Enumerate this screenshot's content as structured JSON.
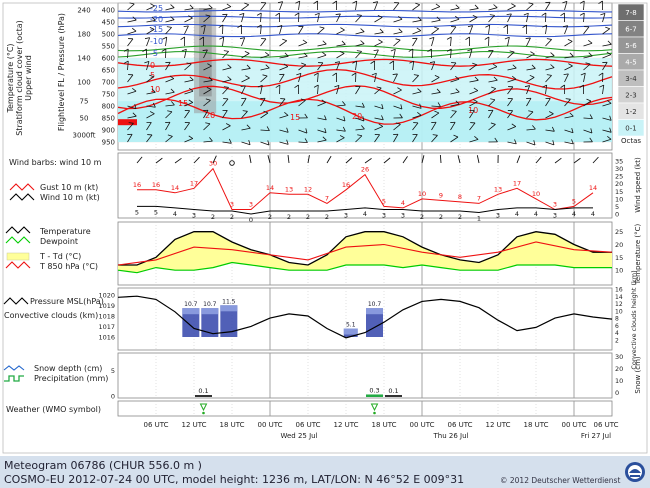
{
  "footer": {
    "title": "Meteogram 06786 (CHUR  556.0 m )",
    "model": "COSMO-EU 2012-07-24  00 UTC, model height: 1236 m,  LAT/LON: N 46°52 E 009°31",
    "copyright": "© 2012 Deutscher Wetterdienst"
  },
  "colors": {
    "temperature": "#000000",
    "dewpoint": "#00cc00",
    "gust": "#ee1111",
    "t850": "#ee1111",
    "fill": "#ffff99",
    "pressure": "#000000",
    "convective": "#3344aa"
  },
  "time_axis": {
    "hour_labels": [
      "06 UTC",
      "12 UTC",
      "18 UTC",
      "00 UTC",
      "06 UTC",
      "12 UTC",
      "18 UTC",
      "00 UTC",
      "06 UTC",
      "12 UTC",
      "18 UTC",
      "00 UTC",
      "06 UTC"
    ],
    "day_labels": [
      "Wed 25 Jul",
      "Thu 26 Jul",
      "Fri 27 Jul"
    ]
  },
  "panels": {
    "upper_air": {
      "left_labels": [
        "Temperature (°C)",
        "Stratiform cloud cover (octa)",
        "Upper wind"
      ],
      "axis_title": "Flightlevel FL / Pressure (hPa)",
      "fl_ticks": [
        "240",
        "180",
        "140",
        "100",
        "75",
        "50",
        "3000ft"
      ],
      "hpa_ticks": [
        "400",
        "450",
        "500",
        "550",
        "600",
        "650",
        "700",
        "750",
        "800",
        "850",
        "900",
        "950"
      ],
      "octa_labels": [
        "7-8",
        "6-7",
        "5-6",
        "4-5",
        "3-4",
        "2-3",
        "1-2",
        "0-1"
      ],
      "octa_title": "Octas",
      "isotherm_labels": [
        "-25",
        "-20",
        "-15",
        "-10",
        "-5",
        "0",
        "5",
        "10",
        "15",
        "20",
        "15",
        "20",
        "10"
      ]
    },
    "wind": {
      "left_labels": [
        "Wind barbs: wind 10 m",
        "Gust 10 m (kt)",
        "Wind 10 m (kt)"
      ],
      "right_title": "Wind speed (kt)",
      "right_ticks": [
        "35",
        "30",
        "25",
        "20",
        "15",
        "10",
        "5",
        "0"
      ]
    },
    "temp": {
      "legend": [
        "Temperature",
        "Dewpoint",
        "T - Td (°C)",
        "T 850 hPa (°C)"
      ],
      "right_title": "Temperature (°C)",
      "right_ticks": [
        "25",
        "20",
        "15",
        "10"
      ]
    },
    "pressure": {
      "legend": [
        "Pressure MSL(hPa)",
        "Convective clouds (km)"
      ],
      "left_ticks": [
        "1020",
        "1019",
        "1018",
        "1017",
        "1016"
      ],
      "right_title": "Convective clouds height (km)",
      "right_ticks": [
        "16",
        "14",
        "12",
        "10",
        "8",
        "6",
        "4",
        "2"
      ]
    },
    "precip": {
      "legend": [
        "Snow depth (cm)",
        "Precipitation (mm)"
      ],
      "left_ticks": [
        "5",
        "0"
      ],
      "right_title": "Snow (cm)",
      "right_ticks": [
        "30",
        "20",
        "10",
        "0"
      ]
    },
    "weather": {
      "legend": "Weather (WMO symbol)"
    }
  },
  "chart_data": [
    {
      "type": "line",
      "title": "Wind 10 m",
      "ylabel": "Wind speed (kt)",
      "ylim": [
        0,
        35
      ],
      "series": [
        {
          "name": "Gust 10 m (kt)",
          "x": [
            3,
            6,
            9,
            12,
            15,
            18,
            21,
            24,
            27,
            30,
            33,
            36,
            39,
            42,
            45,
            48,
            51,
            54,
            57,
            60,
            63,
            66,
            69,
            72,
            75
          ],
          "values": [
            16,
            16,
            14,
            17,
            30,
            3,
            3,
            14,
            13,
            13,
            7,
            16,
            26,
            5,
            4,
            10,
            9,
            8,
            7,
            13,
            17,
            10,
            3,
            5,
            14
          ],
          "labels": [
            "16",
            "16",
            "14",
            "17",
            "30",
            "3",
            "3",
            "14",
            "13",
            "12",
            "7",
            "16",
            "26",
            "5",
            "4",
            "10",
            "9",
            "8",
            "7",
            "13",
            "17",
            "10",
            "3",
            "5",
            "14"
          ]
        },
        {
          "name": "Wind 10 m (kt)",
          "x": [
            3,
            6,
            9,
            12,
            15,
            18,
            21,
            24,
            27,
            30,
            33,
            36,
            39,
            42,
            45,
            48,
            51,
            54,
            57,
            60,
            63,
            66,
            69,
            72,
            75
          ],
          "values": [
            5,
            5,
            4,
            3,
            2,
            2,
            0,
            2,
            2,
            2,
            2,
            3,
            4,
            3,
            3,
            2,
            2,
            2,
            1,
            3,
            4,
            4,
            3,
            4,
            4
          ],
          "labels": [
            "5",
            "5",
            "4",
            "3",
            "2",
            "2",
            "0",
            "2",
            "2",
            "2",
            "2",
            "3",
            "4",
            "3",
            "3",
            "2",
            "2",
            "2",
            "1",
            "3",
            "4",
            "4",
            "3",
            "4",
            "4"
          ]
        }
      ]
    },
    {
      "type": "line",
      "title": "Temperature",
      "ylabel": "Temperature (°C)",
      "ylim": [
        5,
        28
      ],
      "series": [
        {
          "name": "Temperature",
          "x": [
            0,
            3,
            6,
            9,
            12,
            15,
            18,
            21,
            24,
            27,
            30,
            33,
            36,
            39,
            42,
            45,
            48,
            51,
            54,
            57,
            60,
            63,
            66,
            69,
            72,
            75,
            78
          ],
          "values": [
            12,
            12,
            15,
            22,
            25,
            25,
            21,
            18,
            16,
            13,
            12,
            16,
            23,
            25,
            25,
            23,
            19,
            16,
            14,
            13,
            16,
            23,
            25,
            24,
            20,
            17,
            17
          ]
        },
        {
          "name": "Dewpoint",
          "x": [
            0,
            3,
            6,
            9,
            12,
            15,
            18,
            21,
            24,
            27,
            30,
            33,
            36,
            39,
            42,
            45,
            48,
            51,
            54,
            57,
            60,
            63,
            66,
            69,
            72,
            75,
            78
          ],
          "values": [
            10,
            9,
            11,
            10,
            10,
            11,
            13,
            12,
            11,
            10,
            10,
            10,
            12,
            12,
            12,
            11,
            12,
            11,
            10,
            10,
            10,
            12,
            12,
            12,
            11,
            11,
            11
          ]
        },
        {
          "name": "T 850 hPa (°C)",
          "x": [
            0,
            6,
            12,
            18,
            24,
            30,
            36,
            42,
            48,
            54,
            60,
            66,
            72,
            78
          ],
          "values": [
            12,
            14,
            19,
            18,
            16,
            14,
            19,
            20,
            17,
            15,
            17,
            21,
            18,
            17
          ]
        }
      ]
    },
    {
      "type": "line",
      "title": "Pressure MSL",
      "ylabel": "Pressure MSL(hPa)",
      "ylim": [
        1015.5,
        1020.5
      ],
      "series": [
        {
          "name": "Pressure MSL(hPa)",
          "x": [
            0,
            3,
            6,
            9,
            12,
            15,
            18,
            21,
            24,
            27,
            30,
            33,
            36,
            39,
            42,
            45,
            48,
            51,
            54,
            57,
            60,
            63,
            66,
            69,
            72,
            75,
            78
          ],
          "values": [
            1019.8,
            1019.9,
            1019.6,
            1018.4,
            1016.8,
            1016.3,
            1016.5,
            1017.0,
            1017.8,
            1018.2,
            1018.0,
            1016.8,
            1015.9,
            1016.4,
            1017.4,
            1018.6,
            1019.4,
            1019.6,
            1019.4,
            1018.8,
            1017.6,
            1016.6,
            1016.9,
            1017.8,
            1018.2,
            1017.9,
            1017.7
          ]
        }
      ]
    },
    {
      "type": "bar",
      "title": "Convective clouds (km)",
      "ylabel": "Convective clouds height (km)",
      "ylim": [
        0,
        16
      ],
      "bars": [
        {
          "x0": 10,
          "x1": 13,
          "bottom": 0,
          "top": 10.7,
          "label": "10.7"
        },
        {
          "x0": 13,
          "x1": 16,
          "bottom": 0,
          "top": 10.7,
          "label": "10.7"
        },
        {
          "x0": 16,
          "x1": 19,
          "bottom": 0,
          "top": 11.5,
          "label": "11.5"
        },
        {
          "x0": 35.5,
          "x1": 38,
          "bottom": 0,
          "top": 5.1,
          "label": "5.1"
        },
        {
          "x0": 39,
          "x1": 42,
          "bottom": 0,
          "top": 10.7,
          "label": "10.7"
        }
      ]
    },
    {
      "type": "bar",
      "title": "Precipitation (mm)",
      "ylabel": "Precipitation (mm)",
      "ylim": [
        0,
        8
      ],
      "bars": [
        {
          "x0": 12,
          "x1": 15,
          "value": 0.1,
          "label": "0.1"
        },
        {
          "x0": 39,
          "x1": 42,
          "value": 0.3,
          "label": "0.3"
        },
        {
          "x0": 42,
          "x1": 45,
          "value": 0.1,
          "label": "0.1"
        }
      ]
    }
  ]
}
